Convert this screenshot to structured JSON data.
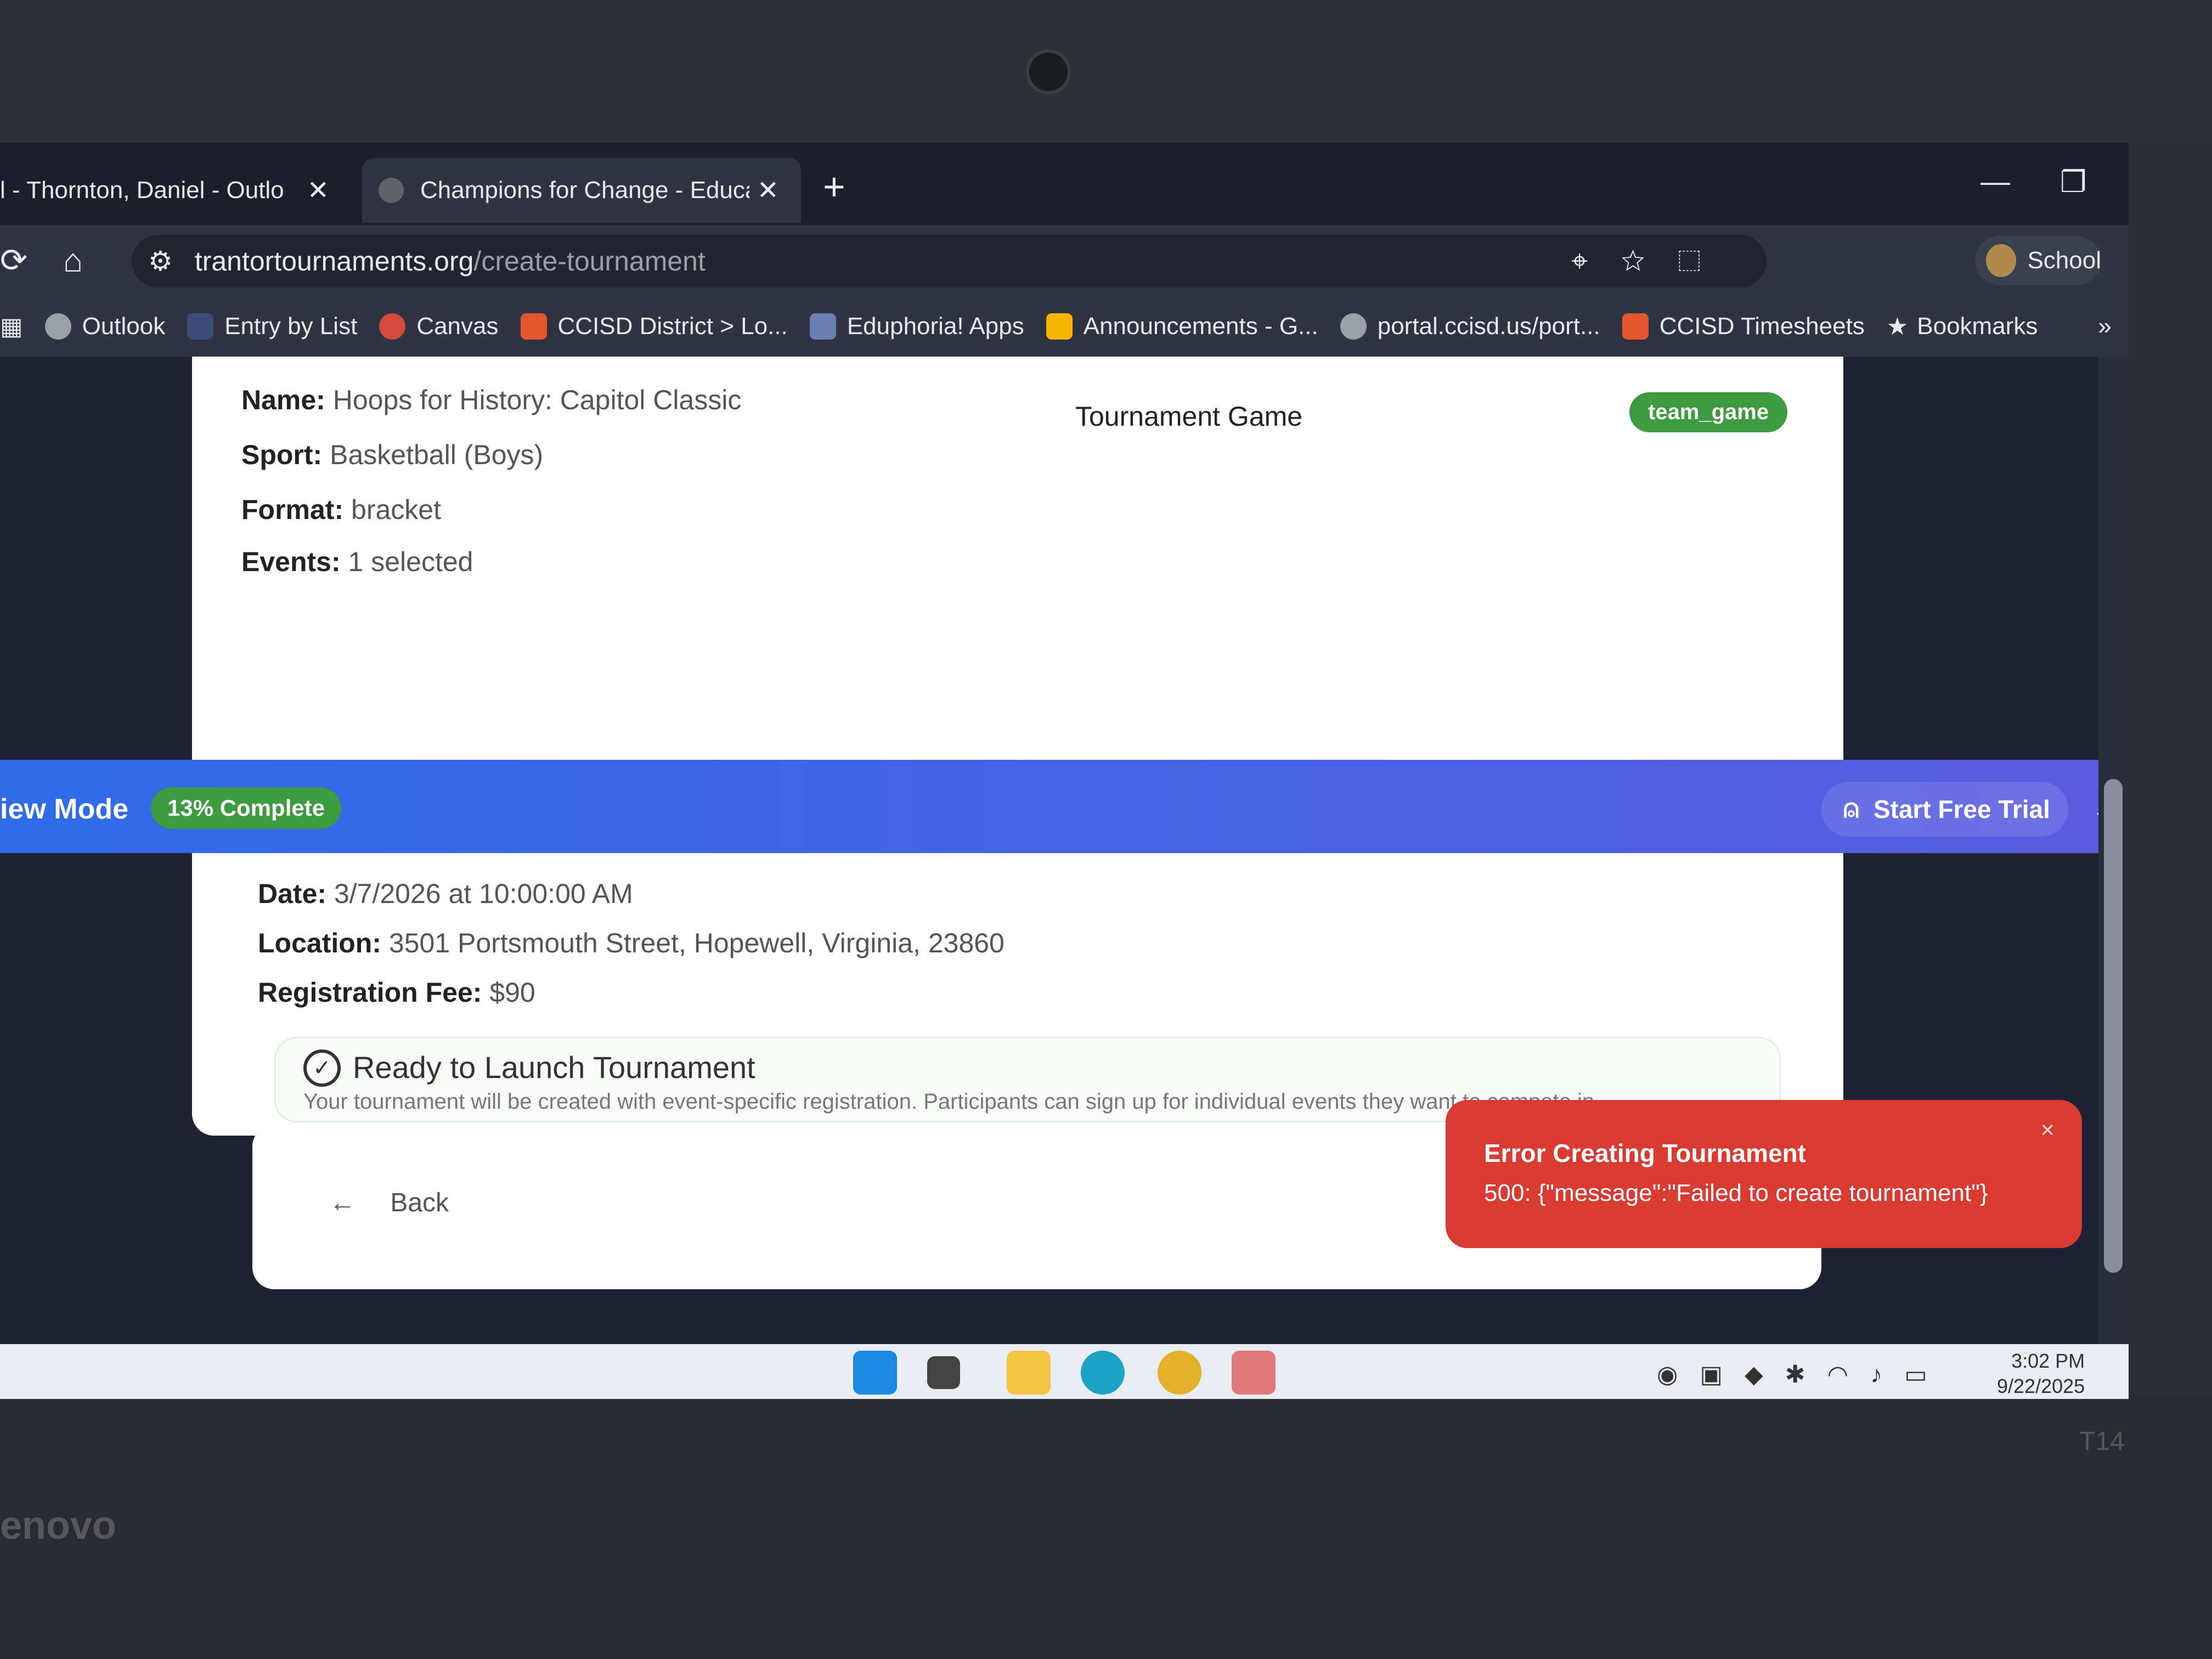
{
  "browser": {
    "tabs": [
      {
        "label": "l - Thornton, Daniel - Outlo",
        "active": false
      },
      {
        "label": "Champions for Change - Educa",
        "active": true
      }
    ],
    "new_tab": "+",
    "address": {
      "host": "trantortournaments.org",
      "path": "/create-tournament"
    },
    "profile_label": "School",
    "bookmarks": [
      {
        "label": "Outlook"
      },
      {
        "label": "Entry by List"
      },
      {
        "label": "Canvas"
      },
      {
        "label": "CCISD District > Lo..."
      },
      {
        "label": "Eduphoria! Apps"
      },
      {
        "label": "Announcements - G..."
      },
      {
        "label": "portal.ccisd.us/port..."
      },
      {
        "label": "CCISD Timesheets"
      },
      {
        "label": "Bookmarks"
      }
    ]
  },
  "summary": {
    "name_label": "Name:",
    "name_value": "Hoops for History: Capitol Classic",
    "sport_label": "Sport:",
    "sport_value": "Basketball (Boys)",
    "format_label": "Format:",
    "format_value": "bracket",
    "events_label": "Events:",
    "events_value": "1 selected",
    "game_label": "Tournament Game",
    "game_badge": "team_game",
    "date_label": "Date:",
    "date_value": "3/7/2026 at 10:00:00 AM",
    "location_label": "Location:",
    "location_value": "3501 Portsmouth Street, Hopewell, Virginia, 23860",
    "fee_label": "Registration Fee:",
    "fee_value": "$90"
  },
  "ready": {
    "title": "Ready to Launch Tournament",
    "description": "Your tournament will be created with event-specific registration. Participants can sign up for individual events they want to compete in."
  },
  "banner": {
    "mode_label": "iew Mode",
    "progress_label": "13% Complete",
    "trial_label": "Start Free Trial"
  },
  "footer": {
    "back_label": "Back"
  },
  "toast": {
    "title": "Error Creating Tournament",
    "message": "500: {\"message\":\"Failed to create tournament\"}",
    "close": "×"
  },
  "taskbar": {
    "time": "3:02 PM",
    "date": "9/22/2025"
  },
  "device": {
    "brand": "enovo",
    "model": "T14"
  },
  "colors": {
    "accent_banner_start": "#2f6be6",
    "accent_banner_end": "#5a5ce0",
    "success_badge": "#3c9a3f",
    "error_toast": "#d93a32"
  }
}
